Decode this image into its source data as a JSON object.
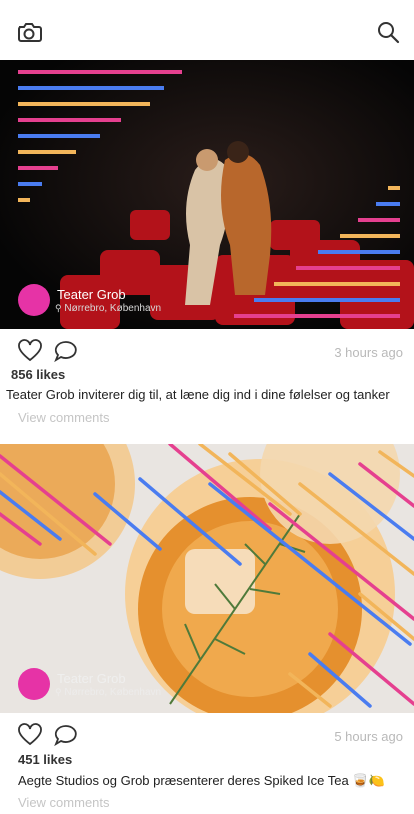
{
  "header": {
    "camera_icon": "camera-icon",
    "search_icon": "search-icon"
  },
  "posts": [
    {
      "author": "Teater Grob",
      "location": "Nørrebro, København",
      "time": "3 hours ago",
      "likes": "856 likes",
      "caption": "Teater Grob inviterer dig til, at læne dig ind i dine følelser og tanker",
      "view_comments": "View comments"
    },
    {
      "author": "Teater Grob",
      "location": "Nørrebro, København",
      "time": "5 hours ago",
      "likes": "451 likes",
      "caption": "Aegte Studios og Grob præsenterer deres Spiked Ice Tea 🥃🍋",
      "view_comments": "View comments"
    }
  ],
  "colors": {
    "accent_pink": "#e633a6",
    "stripe_blue": "#4a7cf0",
    "stripe_orange": "#f2b55a",
    "stripe_pink": "#e5408f"
  }
}
